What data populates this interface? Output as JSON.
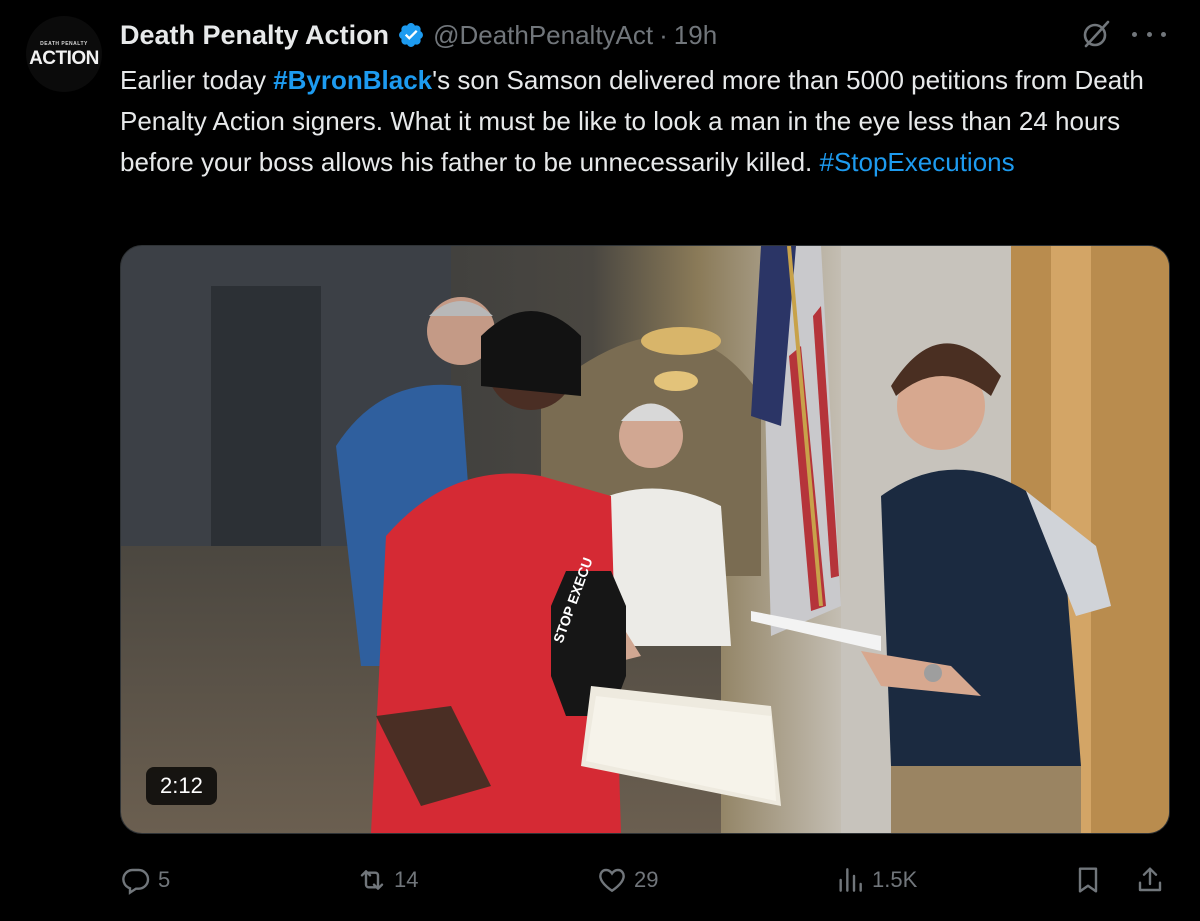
{
  "author": {
    "name": "Death Penalty Action",
    "handle": "@DeathPenaltyAct",
    "separator": "·",
    "time": "19h",
    "avatar": {
      "small_text": "DEATH PENALTY",
      "big_text": "ACTION"
    },
    "verified_icon": "verified-badge-icon"
  },
  "tweet": {
    "segments": {
      "s1": "Earlier today ",
      "tag1": "#ByronBlack",
      "s2": "'s son Samson delivered more than 5000 petitions from Death Penalty Action signers. What it must be like to look a man in the eye less than 24 hours before your boss allows his father to be unnecessarily killed.  ",
      "tag2": "#StopExecutions"
    }
  },
  "media": {
    "type": "video",
    "duration": "2:12",
    "sign_text": "STOP EXECU"
  },
  "actions": {
    "replies": "5",
    "reposts": "14",
    "likes": "29",
    "views": "1.5K"
  },
  "colors": {
    "background": "#000000",
    "text": "#e7e9ea",
    "muted": "#71767b",
    "link": "#1d9bf0",
    "verified": "#1d9bf0"
  }
}
